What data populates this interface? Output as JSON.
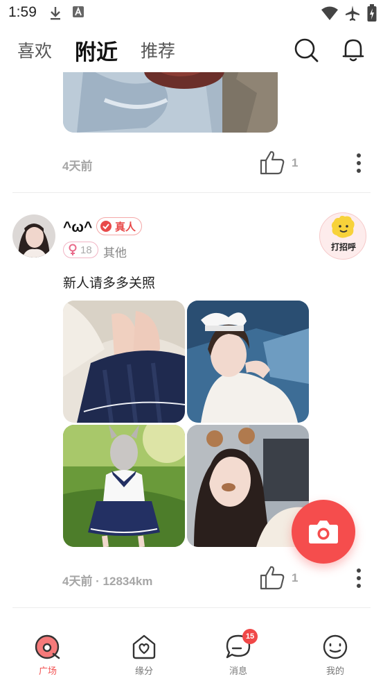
{
  "status_bar": {
    "time": "1:59",
    "left_icons": [
      "download-icon",
      "font-icon"
    ],
    "right_icons": [
      "wifi-icon",
      "airplane-mode-icon",
      "battery-charging-icon"
    ]
  },
  "header": {
    "tabs": [
      {
        "label": "喜欢",
        "active": false
      },
      {
        "label": "附近",
        "active": true
      },
      {
        "label": "推荐",
        "active": false
      }
    ],
    "icons": [
      "search-icon",
      "bell-icon"
    ]
  },
  "posts": [
    {
      "time": "4天前",
      "likes": "1"
    },
    {
      "username": "^ω^",
      "verified_label": "真人",
      "age": "18",
      "gender": "female",
      "tag": "其他",
      "text": "新人请多多关照",
      "greet_label": "打招呼",
      "time_distance": "4天前 · 12834km",
      "likes": "1"
    }
  ],
  "colors": {
    "accent": "#f54d4d",
    "verified": "#e84a4a",
    "meta": "#a6a6a6",
    "active_nav": "#f25252"
  },
  "bottom_nav": [
    {
      "label": "广场",
      "icon": "plaza-icon",
      "active": true
    },
    {
      "label": "缘分",
      "icon": "fate-icon",
      "active": false
    },
    {
      "label": "消息",
      "icon": "message-icon",
      "active": false,
      "badge": "15"
    },
    {
      "label": "我的",
      "icon": "profile-face-icon",
      "active": false
    }
  ]
}
